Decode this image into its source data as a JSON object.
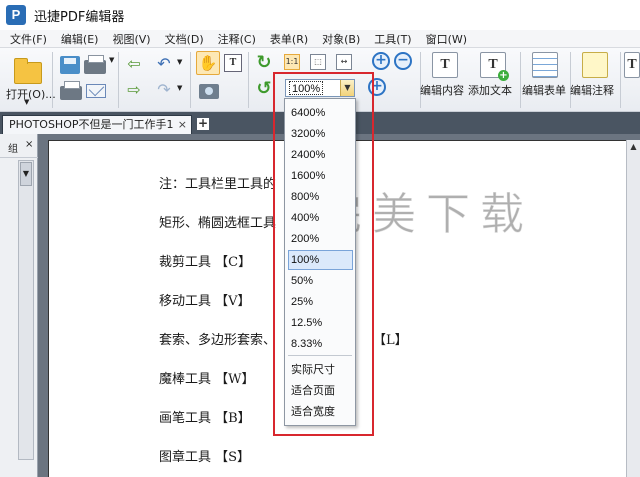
{
  "app": {
    "title": "迅捷PDF编辑器",
    "logo_letter": "P"
  },
  "menu": [
    "文件(F)",
    "编辑(E)",
    "视图(V)",
    "文档(D)",
    "注释(C)",
    "表单(R)",
    "对象(B)",
    "工具(T)",
    "窗口(W)"
  ],
  "toolbar": {
    "open_label": "打开(O)...",
    "zoom_value": "100%",
    "edit_content_label": "编辑内容",
    "add_text_label": "添加文本",
    "edit_form_label": "编辑表单",
    "edit_annotation_label": "编辑注释"
  },
  "tabs": [
    {
      "label": "PHOTOSHOP不但是一门工作手1",
      "close": "×"
    }
  ],
  "tab_add": "+",
  "left_panel": {
    "label": "组",
    "close": "×"
  },
  "zoom_dropdown": {
    "options": [
      "6400%",
      "3200%",
      "2400%",
      "1600%",
      "800%",
      "400%",
      "200%",
      "100%",
      "50%",
      "25%",
      "12.5%",
      "8.33%"
    ],
    "selected": "100%",
    "fit_options": [
      "实际尺寸",
      "适合页面",
      "适合宽度"
    ]
  },
  "document": {
    "lines": [
      "注：工具栏里工具的",
      "矩形、椭圆选框工具",
      "裁剪工具 【C】",
      "移动工具 【V】",
      "套索、多边形套索、",
      "魔棒工具 【W】",
      "画笔工具 【B】",
      "图章工具 【S】"
    ],
    "lasso_shortcut_fragment": "【L】"
  },
  "watermark": "完美下载",
  "colors": {
    "highlight": "#d8272e",
    "accent": "#2d74c4",
    "selection": "#dbe9fb"
  }
}
